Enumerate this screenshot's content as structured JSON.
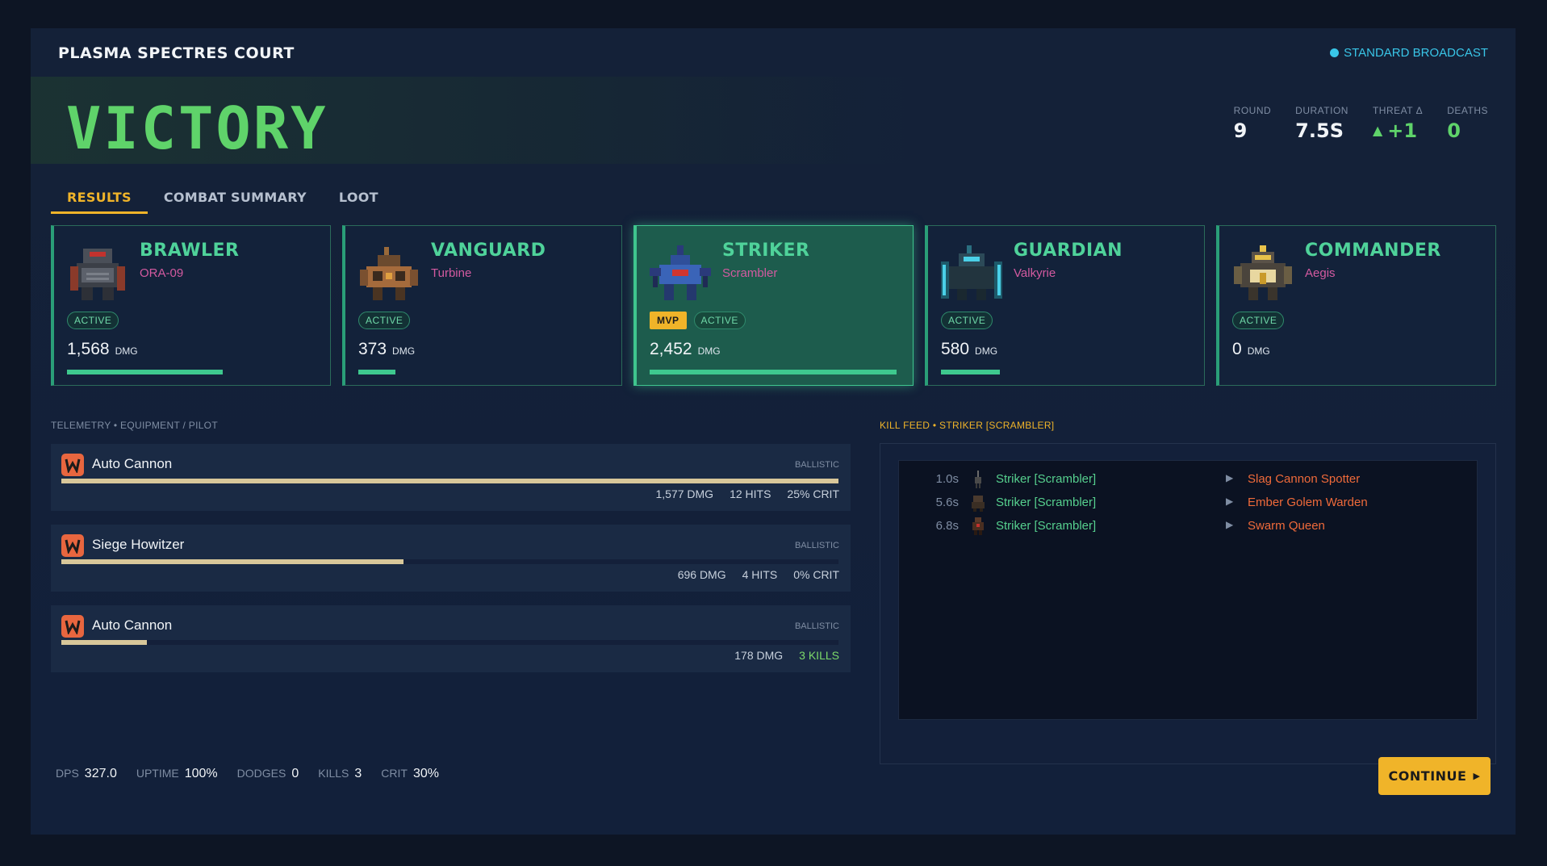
{
  "app": {
    "title": "PLASMA SPECTRES COURT",
    "broadcast": "STANDARD BROADCAST"
  },
  "hero": {
    "result": "VICTORY"
  },
  "stats": [
    {
      "label": "ROUND",
      "value": "9"
    },
    {
      "label": "DURATION",
      "value": "7.5S"
    },
    {
      "label": "THREAT Δ",
      "value": "+1"
    },
    {
      "label": "DEATHS",
      "value": "0"
    }
  ],
  "tabs": [
    "RESULTS",
    "COMBAT SUMMARY",
    "LOOT"
  ],
  "cards": [
    {
      "name": "BRAWLER",
      "pilot": "ORA-09",
      "status": "ACTIVE",
      "dmg": "1,568",
      "unit": "DMG",
      "dmg_fraction": 0.63
    },
    {
      "name": "VANGUARD",
      "pilot": "Turbine",
      "status": "ACTIVE",
      "dmg": "373",
      "unit": "DMG",
      "dmg_fraction": 0.15
    },
    {
      "name": "STRIKER",
      "pilot": "Scrambler",
      "mvp": "MVP",
      "status": "ACTIVE",
      "dmg": "2,452",
      "unit": "DMG",
      "dmg_fraction": 1.0
    },
    {
      "name": "GUARDIAN",
      "pilot": "Valkyrie",
      "status": "ACTIVE",
      "dmg": "580",
      "unit": "DMG",
      "dmg_fraction": 0.24
    },
    {
      "name": "COMMANDER",
      "pilot": "Aegis",
      "status": "ACTIVE",
      "dmg": "0",
      "unit": "DMG",
      "dmg_fraction": 0
    }
  ],
  "telemetry": {
    "label": "TELEMETRY • EQUIPMENT / PILOT",
    "items": [
      {
        "name": "Auto Cannon",
        "category": "BALLISTIC",
        "fraction": 1.0,
        "stats": [
          "1,577 DMG",
          "12 HITS",
          "25% CRIT"
        ]
      },
      {
        "name": "Siege Howitzer",
        "category": "BALLISTIC",
        "fraction": 0.44,
        "stats": [
          "696 DMG",
          "4 HITS",
          "0% CRIT"
        ]
      },
      {
        "name": "Auto Cannon",
        "category": "BALLISTIC",
        "fraction": 0.11,
        "stats": [
          "178 DMG"
        ],
        "kills": "3 KILLS"
      }
    ]
  },
  "killfeed": {
    "label": "KILL FEED • STRIKER [SCRAMBLER]",
    "rows": [
      {
        "time": "1.0s",
        "actor": "Striker [Scrambler]",
        "victim": "Slag Cannon Spotter"
      },
      {
        "time": "5.6s",
        "actor": "Striker [Scrambler]",
        "victim": "Ember Golem Warden"
      },
      {
        "time": "6.8s",
        "actor": "Striker [Scrambler]",
        "victim": "Swarm Queen"
      }
    ]
  },
  "summary": [
    {
      "key": "DPS",
      "value": "327.0"
    },
    {
      "key": "UPTIME",
      "value": "100%"
    },
    {
      "key": "DODGES",
      "value": "0"
    },
    {
      "key": "KILLS",
      "value": "3"
    },
    {
      "key": "CRIT",
      "value": "30%"
    }
  ],
  "continue_label": "CONTINUE",
  "colors": {
    "accent": "#f0b429",
    "victory": "#5fd36a",
    "active": "#3ec88e",
    "enemy": "#ef6a3a"
  }
}
